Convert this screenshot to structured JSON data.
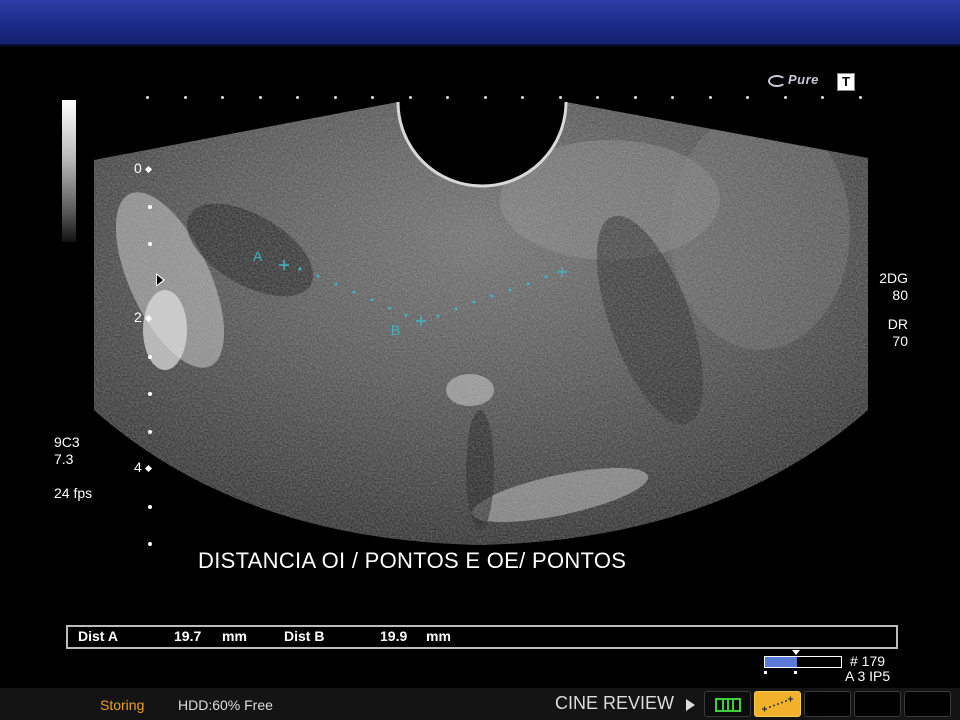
{
  "overlay": {
    "brand_logo": "Pure",
    "mode_badge": "T",
    "depth_marks": [
      "0",
      "2",
      "4"
    ],
    "probe": "9C3",
    "frequency": "7.3",
    "frame_rate": "24 fps",
    "gain_label": "2DG",
    "gain_value": "80",
    "dr_label": "DR",
    "dr_value": "70",
    "caliper_a": "A",
    "caliper_b": "B",
    "caliper_color": "#3fb6c4",
    "caption": "DISTANCIA OI / PONTOS E OE/ PONTOS"
  },
  "measurements": {
    "dist_a_label": "Dist A",
    "dist_a_value": "19.7",
    "dist_a_unit": "mm",
    "dist_b_label": "Dist B",
    "dist_b_value": "19.9",
    "dist_b_unit": "mm"
  },
  "cine": {
    "frame_number": "# 179",
    "line2": "A 3   IP5",
    "slider_position": 0.42,
    "slider_color": "#5b7ad6"
  },
  "status": {
    "storing": "Storing",
    "hdd": "HDD:60% Free",
    "cine_review": "CINE REVIEW",
    "storing_color": "#f0a020",
    "active_tool_color": "#f2b12a"
  },
  "icons": {
    "cine_play": "play-triangle-icon",
    "film": "film-strip-icon",
    "measure": "caliper-measure-icon",
    "focus": "focus-marker-icon"
  }
}
